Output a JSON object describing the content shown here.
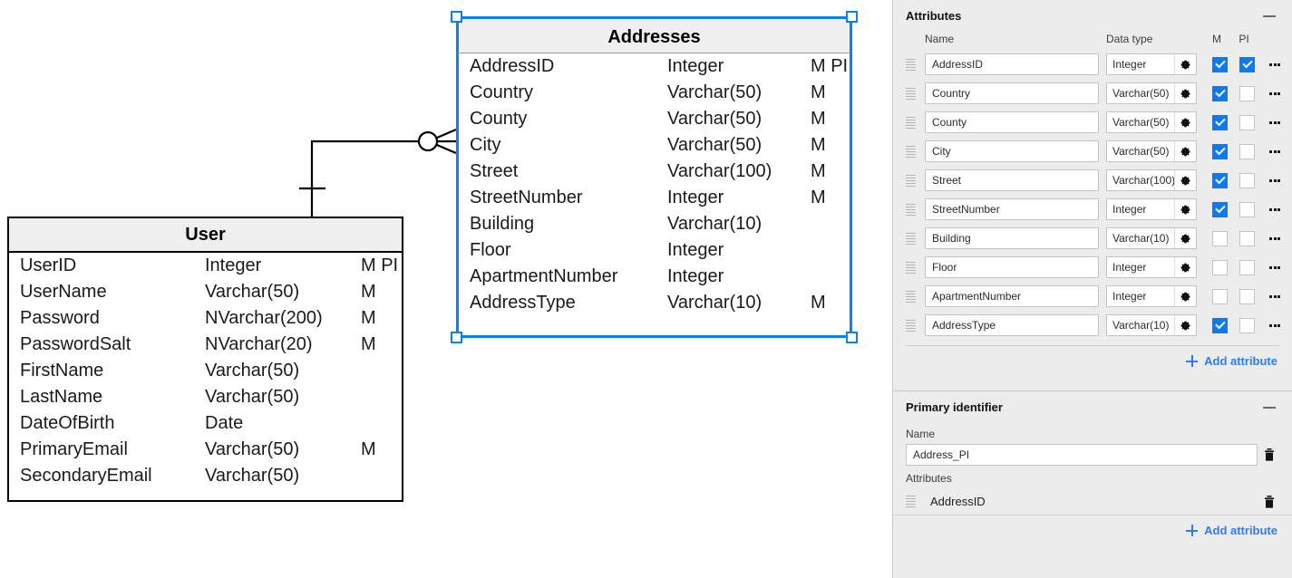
{
  "canvas": {
    "entities": [
      {
        "name": "User",
        "selected": false,
        "attributes": [
          {
            "name": "UserID",
            "type": "Integer",
            "flags": "M PI"
          },
          {
            "name": "UserName",
            "type": "Varchar(50)",
            "flags": "M"
          },
          {
            "name": "Password",
            "type": "NVarchar(200)",
            "flags": "M"
          },
          {
            "name": "PasswordSalt",
            "type": "NVarchar(20)",
            "flags": "M"
          },
          {
            "name": "FirstName",
            "type": "Varchar(50)",
            "flags": ""
          },
          {
            "name": "LastName",
            "type": "Varchar(50)",
            "flags": ""
          },
          {
            "name": "DateOfBirth",
            "type": "Date",
            "flags": ""
          },
          {
            "name": "PrimaryEmail",
            "type": "Varchar(50)",
            "flags": "M"
          },
          {
            "name": "SecondaryEmail",
            "type": "Varchar(50)",
            "flags": ""
          }
        ]
      },
      {
        "name": "Addresses",
        "selected": true,
        "attributes": [
          {
            "name": "AddressID",
            "type": "Integer",
            "flags": "M PI"
          },
          {
            "name": "Country",
            "type": "Varchar(50)",
            "flags": "M"
          },
          {
            "name": "County",
            "type": "Varchar(50)",
            "flags": "M"
          },
          {
            "name": "City",
            "type": "Varchar(50)",
            "flags": "M"
          },
          {
            "name": "Street",
            "type": "Varchar(100)",
            "flags": "M"
          },
          {
            "name": "StreetNumber",
            "type": "Integer",
            "flags": "M"
          },
          {
            "name": "Building",
            "type": "Varchar(10)",
            "flags": ""
          },
          {
            "name": "Floor",
            "type": "Integer",
            "flags": ""
          },
          {
            "name": "ApartmentNumber",
            "type": "Integer",
            "flags": ""
          },
          {
            "name": "AddressType",
            "type": "Varchar(10)",
            "flags": "M"
          }
        ]
      }
    ],
    "selection_color": "#0a82e6"
  },
  "panel": {
    "attributes_section": {
      "title": "Attributes",
      "columns": {
        "name": "Name",
        "data_type": "Data type",
        "mandatory": "M",
        "primary_identifier": "PI"
      },
      "rows": [
        {
          "name": "AddressID",
          "type": "Integer",
          "m": true,
          "pi": true
        },
        {
          "name": "Country",
          "type": "Varchar(50)",
          "m": true,
          "pi": false
        },
        {
          "name": "County",
          "type": "Varchar(50)",
          "m": true,
          "pi": false
        },
        {
          "name": "City",
          "type": "Varchar(50)",
          "m": true,
          "pi": false
        },
        {
          "name": "Street",
          "type": "Varchar(100)",
          "m": true,
          "pi": false
        },
        {
          "name": "StreetNumber",
          "type": "Integer",
          "m": true,
          "pi": false
        },
        {
          "name": "Building",
          "type": "Varchar(10)",
          "m": false,
          "pi": false
        },
        {
          "name": "Floor",
          "type": "Integer",
          "m": false,
          "pi": false
        },
        {
          "name": "ApartmentNumber",
          "type": "Integer",
          "m": false,
          "pi": false
        },
        {
          "name": "AddressType",
          "type": "Varchar(10)",
          "m": true,
          "pi": false
        }
      ],
      "add_attribute_label": "Add attribute"
    },
    "primary_identifier_section": {
      "title": "Primary identifier",
      "name_label": "Name",
      "name_value": "Address_PI",
      "attributes_label": "Attributes",
      "attributes": [
        {
          "name": "AddressID"
        }
      ],
      "add_attribute_label": "Add attribute"
    },
    "accent_color": "#2b7cf5",
    "checkbox_color": "#0a7bf5"
  }
}
